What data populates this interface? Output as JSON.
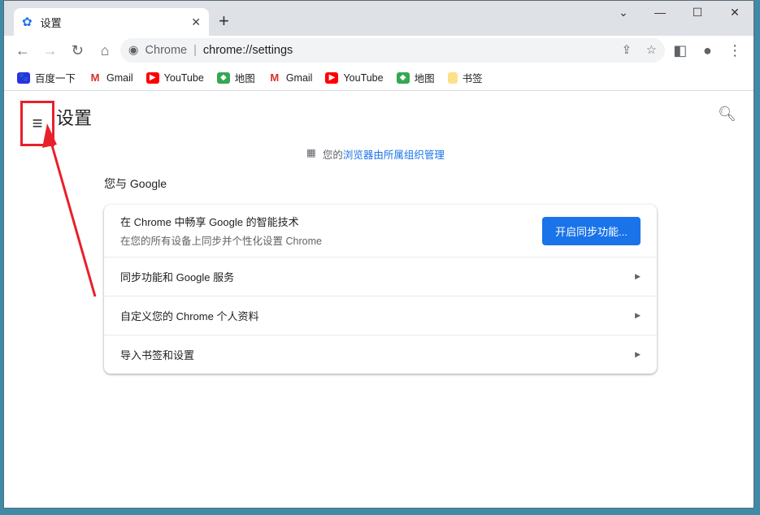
{
  "tab": {
    "title": "设置"
  },
  "address": {
    "chip": "Chrome",
    "url": "chrome://settings"
  },
  "bookmarks": [
    {
      "label": "百度一下",
      "icon": "baidu-icon"
    },
    {
      "label": "Gmail",
      "icon": "gmail-icon"
    },
    {
      "label": "YouTube",
      "icon": "youtube-icon"
    },
    {
      "label": "地图",
      "icon": "maps-icon"
    },
    {
      "label": "Gmail",
      "icon": "gmail-icon"
    },
    {
      "label": "YouTube",
      "icon": "youtube-icon"
    },
    {
      "label": "地图",
      "icon": "maps-icon"
    },
    {
      "label": "书签",
      "icon": "folder-icon"
    }
  ],
  "page": {
    "title": "设置",
    "managed_prefix": "您的",
    "managed_link": "浏览器由所属组织管理",
    "section": "您与 Google",
    "sync": {
      "title": "在 Chrome 中畅享 Google 的智能技术",
      "subtitle": "在您的所有设备上同步并个性化设置 Chrome",
      "button": "开启同步功能..."
    },
    "rows": [
      "同步功能和 Google 服务",
      "自定义您的 Chrome 个人资料",
      "导入书签和设置"
    ]
  },
  "colors": {
    "accent": "#1a73e8",
    "annotation": "#e8202a"
  }
}
